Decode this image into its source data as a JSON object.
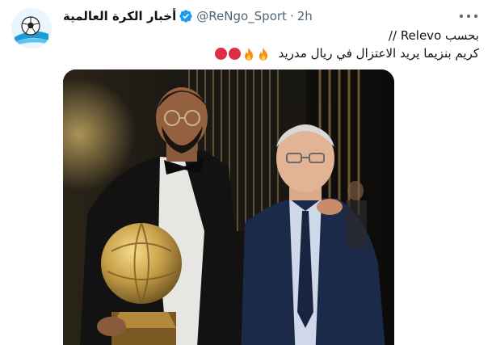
{
  "author": {
    "display_name": "أخبار الكرة العالمية",
    "handle": "@ReNgo_Sport",
    "separator": "·",
    "timestamp": "2h",
    "verified": true,
    "avatar_icon": "soccer-ball-logo-icon"
  },
  "tweet": {
    "line1": "بحسب Relevo //",
    "line2": "كريم بنزيما يريد الاعتزال في ريال مدريد",
    "emojis": [
      "fire",
      "fire",
      "red-circle",
      "red-circle"
    ]
  },
  "media": {
    "type": "photo",
    "alt": ""
  },
  "colors": {
    "verified": "#1d9bf0",
    "secondary_text": "#536471",
    "primary_text": "#0f1419",
    "emoji_red": "#dd2e44",
    "gold": "#c9a24a"
  }
}
